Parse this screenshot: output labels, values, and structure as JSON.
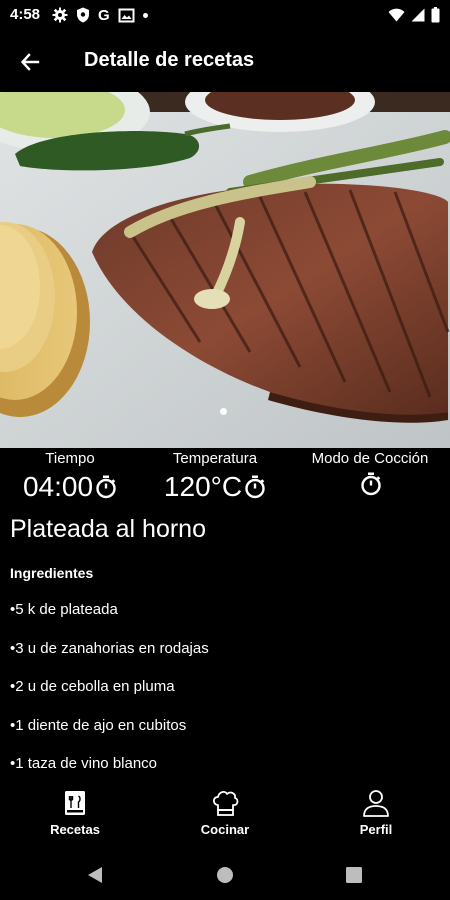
{
  "status_bar": {
    "time": "4:58",
    "left_icons": [
      "gear-icon",
      "shield-icon",
      "google-g-icon",
      "image-icon",
      "dot-icon"
    ],
    "google_letter": "G",
    "right_icons": [
      "wifi-icon",
      "signal-icon",
      "battery-icon"
    ]
  },
  "app_bar": {
    "back_icon": "arrow-left-icon",
    "title": "Detalle de recetas"
  },
  "hero": {
    "image_alt": "steak-photo",
    "pager_dots": 1,
    "active_index": 0
  },
  "stats": [
    {
      "label": "Tiempo",
      "value": "04:00",
      "icon": "timer-icon"
    },
    {
      "label": "Temperatura",
      "value": "120°C",
      "icon": "timer-icon"
    },
    {
      "label": "Modo de Cocción",
      "value": "",
      "icon": "timer-icon"
    }
  ],
  "recipe": {
    "title": "Plateada al horno",
    "ingredients_heading": "Ingredientes",
    "ingredients": [
      "•5 k de plateada",
      "•3 u de zanahorias en rodajas",
      "•2 u de cebolla en pluma",
      "•1 diente de ajo en cubitos",
      "•1 taza de vino blanco"
    ]
  },
  "bottom_nav": [
    {
      "label": "Recetas",
      "icon": "recipe-book-icon"
    },
    {
      "label": "Cocinar",
      "icon": "chef-hat-icon"
    },
    {
      "label": "Perfil",
      "icon": "person-icon"
    }
  ],
  "system_nav": [
    "back-triangle-icon",
    "home-circle-icon",
    "recents-square-icon"
  ],
  "colors": {
    "background": "#000000",
    "text": "#ffffff"
  }
}
